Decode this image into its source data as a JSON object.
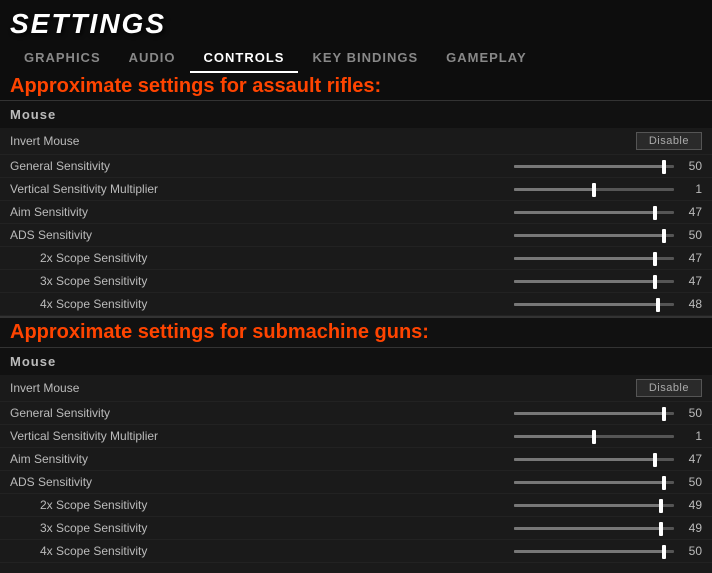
{
  "header": {
    "title": "SETTINGS",
    "tabs": [
      {
        "label": "GRAPHICS",
        "active": false
      },
      {
        "label": "AUDIO",
        "active": false
      },
      {
        "label": "CONTROLS",
        "active": true
      },
      {
        "label": "KEY BINDINGS",
        "active": false
      },
      {
        "label": "GAMEPLAY",
        "active": false
      }
    ]
  },
  "annotation_assault": "Approximate settings for assault rifles:",
  "annotation_smg": "Approximate settings for submachine guns:",
  "section1": {
    "label": "Mouse",
    "rows": [
      {
        "label": "Invert Mouse",
        "type": "toggle",
        "value": "Disable"
      },
      {
        "label": "General Sensitivity",
        "type": "slider",
        "percent": 94,
        "value": "50"
      },
      {
        "label": "Vertical Sensitivity Multiplier",
        "type": "slider",
        "percent": 50,
        "value": "1"
      },
      {
        "label": "Aim Sensitivity",
        "type": "slider",
        "percent": 88,
        "value": "47"
      },
      {
        "label": "ADS Sensitivity",
        "type": "slider",
        "percent": 94,
        "value": "50"
      },
      {
        "label": "2x Scope Sensitivity",
        "type": "slider",
        "percent": 88,
        "value": "47"
      },
      {
        "label": "3x Scope Sensitivity",
        "type": "slider",
        "percent": 88,
        "value": "47"
      },
      {
        "label": "4x Scope Sensitivity",
        "type": "slider",
        "percent": 90,
        "value": "48"
      }
    ]
  },
  "section2": {
    "label": "Mouse",
    "rows": [
      {
        "label": "Invert Mouse",
        "type": "toggle",
        "value": "Disable"
      },
      {
        "label": "General Sensitivity",
        "type": "slider",
        "percent": 94,
        "value": "50"
      },
      {
        "label": "Vertical Sensitivity Multiplier",
        "type": "slider",
        "percent": 50,
        "value": "1"
      },
      {
        "label": "Aim Sensitivity",
        "type": "slider",
        "percent": 88,
        "value": "47"
      },
      {
        "label": "ADS Sensitivity",
        "type": "slider",
        "percent": 94,
        "value": "50"
      },
      {
        "label": "2x Scope Sensitivity",
        "type": "slider",
        "percent": 92,
        "value": "49"
      },
      {
        "label": "3x Scope Sensitivity",
        "type": "slider",
        "percent": 92,
        "value": "49"
      },
      {
        "label": "4x Scope Sensitivity",
        "type": "slider",
        "percent": 94,
        "value": "50"
      }
    ]
  }
}
